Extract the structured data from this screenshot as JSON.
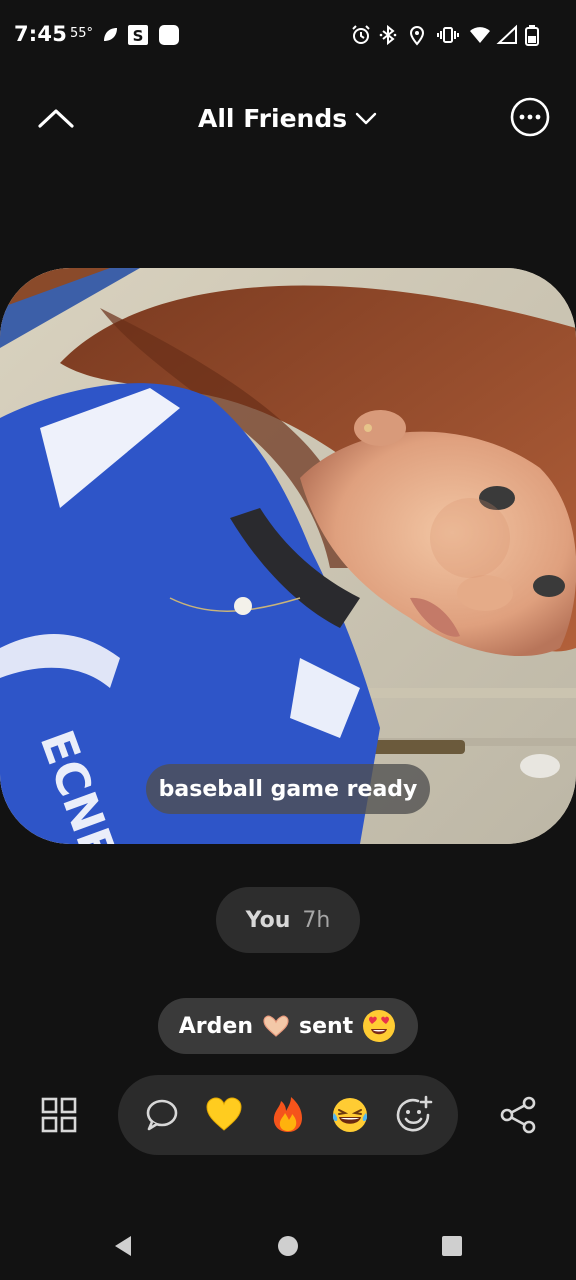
{
  "status_bar": {
    "time": "7:45",
    "temperature": "55°",
    "icons": [
      "notification-icon",
      "s-app-icon",
      "square-app-icon",
      "alarm-icon",
      "bluetooth-icon",
      "location-icon",
      "vibrate-icon",
      "wifi-icon",
      "signal-icon",
      "battery-icon"
    ]
  },
  "header": {
    "audience_label": "All Friends",
    "icons": [
      "chevron-up-icon",
      "chevron-down-icon",
      "more-options-icon"
    ]
  },
  "photo": {
    "caption": "baseball game ready"
  },
  "post_meta": {
    "author": "You",
    "time_ago": "7h"
  },
  "reaction_notice": {
    "friend_name": "Arden",
    "action": "sent",
    "name_emoji": "heart-hands",
    "reaction_emoji": "heart-eyes"
  },
  "reaction_bar": {
    "items": [
      "comment-icon",
      "yellow-heart-emoji",
      "fire-emoji",
      "laughing-emoji",
      "add-reaction-icon"
    ]
  },
  "colors": {
    "background": "#121212",
    "pill_dark": "#2d2d2d",
    "pill_medium": "#3a3a3a"
  }
}
